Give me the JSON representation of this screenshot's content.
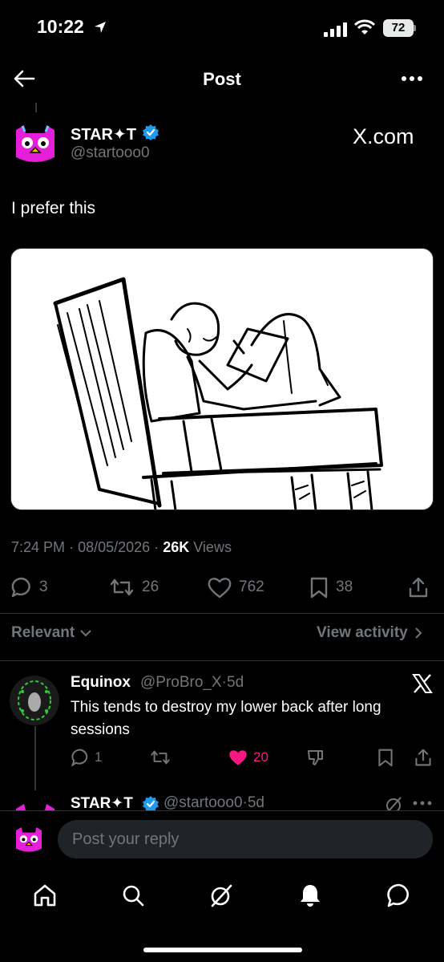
{
  "status_bar": {
    "time": "10:22",
    "battery": "72"
  },
  "nav": {
    "title": "Post",
    "back_icon": "arrow-left-icon",
    "more_icon": "more-horizontal-icon"
  },
  "post": {
    "author_name": "STAR✦T",
    "author_handle": "@startooo0",
    "source_label": "X.com",
    "text": "I prefer this",
    "image_description_icon": "post-image",
    "time": "7:24 PM",
    "date": "08/05/2026",
    "views_count": "26K",
    "views_label": "Views",
    "separator": "·",
    "actions": {
      "replies": "3",
      "reposts": "26",
      "likes": "762",
      "bookmarks": "38"
    }
  },
  "replies_header": {
    "sort_label": "Relevant",
    "activity_label": "View activity"
  },
  "replies": [
    {
      "name": "Equinox",
      "handle": "@ProBro_X",
      "age": "5d",
      "text": "This tends to destroy my lower back after long sessions",
      "replies": "1",
      "likes": "20",
      "liked": true
    },
    {
      "name": "STAR✦T",
      "handle": "@startooo0",
      "age": "5d"
    }
  ],
  "composer": {
    "placeholder": "Post your reply"
  },
  "colors": {
    "background": "#000000",
    "text": "#e7e9ea",
    "muted": "#71767b",
    "like": "#f91880",
    "verified": "#1d9bf0",
    "avatar_pink": "#e51fd9"
  }
}
